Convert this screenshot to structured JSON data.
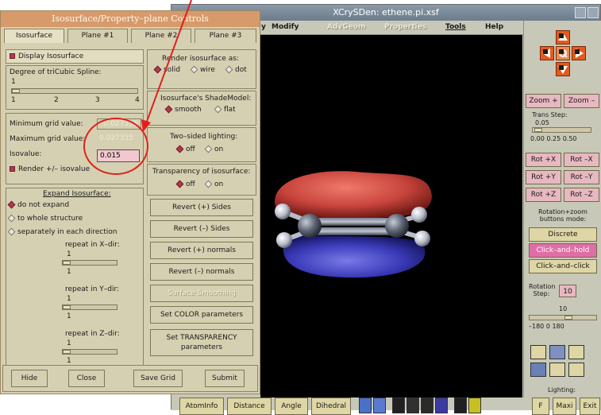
{
  "main_window": {
    "title": "XCrySDen: ethene.pi.xsf",
    "menus": [
      "y",
      "Modify",
      "AdvGeom",
      "Properties",
      "Tools",
      "Help"
    ],
    "disabled_menus": [
      "AdvGeom",
      "Properties"
    ]
  },
  "right_panel": {
    "zoom_plus": "Zoom +",
    "zoom_minus": "Zoom –",
    "trans_step_label": "Trans Step:",
    "trans_step_value": "0.05",
    "trans_ticks": "0.00  0.25  0.50",
    "rot_buttons": [
      "Rot +X",
      "Rot –X",
      "Rot +Y",
      "Rot –Y",
      "Rot +Z",
      "Rot –Z"
    ],
    "rotzoom_label": "Rotation+zoom buttons mode:",
    "mode_buttons": [
      "Discrete",
      "Click–and–hold",
      "Click–and–click"
    ],
    "rotation_step_label": "Rotation Step:",
    "rotation_step_value": "10",
    "rotation_slider_value": "10",
    "rotation_ticks": "–180   0   180",
    "lighting_label": "Lighting:"
  },
  "bottom_toolbar": {
    "buttons": [
      "AtomInfo",
      "Distance",
      "Angle",
      "Dihedral"
    ],
    "corner_buttons": [
      "F",
      "Maxi",
      "Exit"
    ]
  },
  "dialog": {
    "title": "Isosurface/Property–plane Controls",
    "tabs": [
      "Isosurface",
      "Plane #1",
      "Plane #2",
      "Plane #3"
    ],
    "display_isosurface": "Display Isosurface",
    "degree_label": "Degree of triCubic Spline:",
    "degree_value": "1",
    "degree_ticks": [
      "1",
      "2",
      "3",
      "4"
    ],
    "min_grid_label": "Minimum grid value:",
    "min_grid_value": "–0.027335",
    "max_grid_label": "Maximum grid value:",
    "max_grid_value": "0.027335",
    "isovalue_label": "Isovalue:",
    "isovalue": "0.015",
    "render_pm": "Render +/– isovalue",
    "expand_label": "Expand Isosurface:",
    "expand_options": [
      "do not expand",
      "to whole structure",
      "separately in each direction"
    ],
    "repeat_x_label": "repeat in X–dir:",
    "repeat_y_label": "repeat in Y–dir:",
    "repeat_z_label": "repeat in Z–dir:",
    "repeat_value": "1",
    "repeat_min": "1",
    "render_as_label": "Render isosurface as:",
    "render_as_options": [
      "solid",
      "wire",
      "dot"
    ],
    "shade_label": "Isosurface's ShadeModel:",
    "shade_options": [
      "smooth",
      "flat"
    ],
    "two_sided_label": "Two–sided lighting:",
    "transparency_label": "Transparency of isosurface:",
    "off_on": [
      "off",
      "on"
    ],
    "revert_pos_sides": "Revert (+) Sides",
    "revert_neg_sides": "Revert (–) Sides",
    "revert_pos_normals": "Revert (+) normals",
    "revert_neg_normals": "Revert (–) normals",
    "surface_smoothing": "Surface Smoothing",
    "set_color": "Set COLOR parameters",
    "set_transparency": "Set TRANSPARENCY parameters",
    "footer": [
      "Hide",
      "Close",
      "Save Grid",
      "Submit"
    ]
  },
  "colors": {
    "dialog_bg": "#d6d0b2",
    "title_bar": "#d79a6a",
    "positive_lobe": "#c8443c",
    "negative_lobe": "#3a3ab8",
    "annotation": "#e0201c"
  }
}
